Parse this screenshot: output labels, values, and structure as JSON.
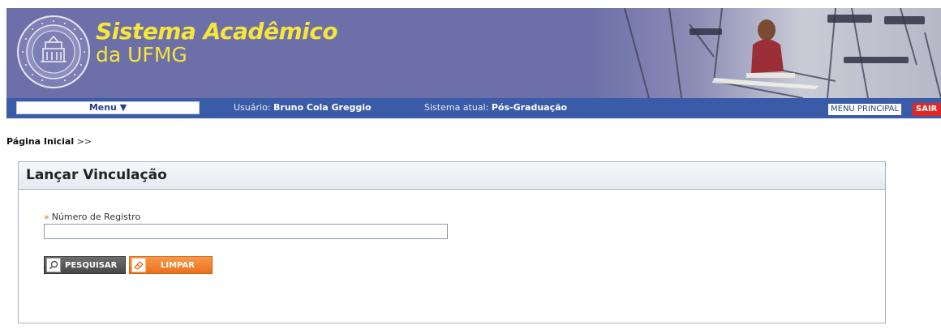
{
  "header": {
    "title": "Sistema Acadêmico",
    "subtitle": "da UFMG",
    "seal_icon": "ufmg-seal-icon",
    "colors": {
      "banner": "#6d70a8",
      "title": "#f6e53a",
      "navbar": "#3a5ba8"
    }
  },
  "nav": {
    "menu_label": "Menu ▼",
    "user_label": "Usuário:",
    "user_name": "Bruno Cola Greggio",
    "system_label": "Sistema atual:",
    "system_name": "Pós-Graduação",
    "menu_principal_label": "MENU PRINCIPAL",
    "sair_label": "SAIR"
  },
  "breadcrumb": {
    "home_label": "Página Inicial",
    "separator": ">>"
  },
  "panel": {
    "title": "Lançar Vinculação",
    "field_label": "Número de Registro",
    "field_value": "",
    "required_marker": "»"
  },
  "actions": {
    "pesquisar_label": "PESQUISAR",
    "pesquisar_icon": "search-icon",
    "limpar_label": "LIMPAR",
    "limpar_icon": "eraser-icon",
    "colors": {
      "pesquisar": "#555555",
      "limpar": "#ec6f1d"
    }
  }
}
